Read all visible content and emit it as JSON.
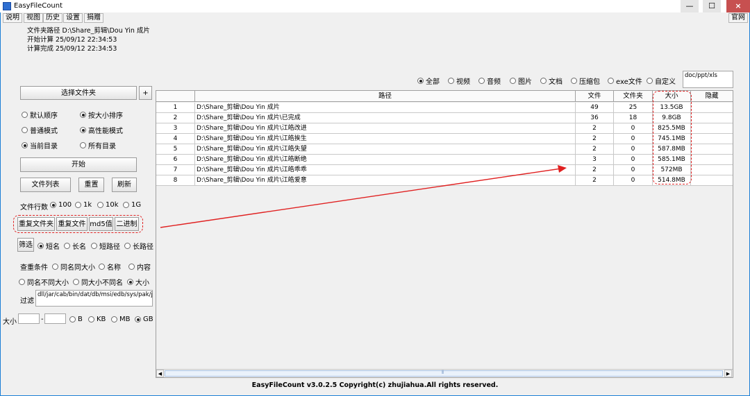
{
  "window": {
    "title": "EasyFileCount",
    "minimize_glyph": "—",
    "maximize_glyph": "☐",
    "close_glyph": "×"
  },
  "menu": [
    "说明",
    "视图",
    "历史",
    "设置",
    "捐赠"
  ],
  "homepage_label": "官网",
  "info": {
    "folder_path": "文件夹路径 D:\\Share_剪辑\\Dou Yin 成片",
    "start_time": "开始计算 25/09/12 22:34:53",
    "end_time": "计算完成 25/09/12 22:34:53"
  },
  "controls": {
    "select_folder": "选择文件夹",
    "plus": "+",
    "sort_default": "默认顺序",
    "sort_size": "按大小排序",
    "mode_normal": "普通模式",
    "mode_perf": "高性能模式",
    "dir_current": "当前目录",
    "dir_all": "所有目录",
    "start": "开始",
    "file_list": "文件列表",
    "reset": "重置",
    "refresh": "刷新",
    "line_count_label": "文件行数",
    "line_counts": [
      "100",
      "1k",
      "10k",
      "1G"
    ],
    "dup_folder": "重复文件夹",
    "dup_file": "重复文件",
    "md5": "md5值",
    "binary": "二进制",
    "filter_btn": "筛选",
    "filter_short_name": "短名",
    "filter_long_name": "长名",
    "filter_short_path": "短路径",
    "filter_long_path": "长路径",
    "dup_cond_label": "查重条件",
    "cond_same_name_size": "同名同大小",
    "cond_name": "名称",
    "cond_content": "内容",
    "cond_same_name_diff_size": "同名不同大小",
    "cond_same_size_diff_name": "同大小不同名",
    "cond_size": "大小",
    "exclude_label": "过滤",
    "exclude_value": "dll/jar/cab/bin/dat/db/msi/edb/sys/pak/jsa",
    "size_label": "大小",
    "size_dash": "-",
    "size_units": [
      "B",
      "KB",
      "MB",
      "GB"
    ]
  },
  "types": {
    "options": [
      "全部",
      "视频",
      "音频",
      "图片",
      "文档",
      "压缩包",
      "exe文件",
      "自定义"
    ],
    "selected": "全部",
    "custom_value": "doc/ppt/xls"
  },
  "table": {
    "columns": [
      "",
      "路径",
      "文件",
      "文件夹",
      "大小",
      "隐藏"
    ],
    "rows": [
      {
        "idx": "1",
        "path": "D:\\Share_剪辑\\Dou Yin 成片",
        "files": "49",
        "folders": "25",
        "size": "13.5GB",
        "hidden": ""
      },
      {
        "idx": "2",
        "path": "D:\\Share_剪辑\\Dou Yin 成片\\已完成",
        "files": "36",
        "folders": "18",
        "size": "9.8GB",
        "hidden": ""
      },
      {
        "idx": "3",
        "path": "D:\\Share_剪辑\\Dou Yin 成片\\江皓改进",
        "files": "2",
        "folders": "0",
        "size": "825.5MB",
        "hidden": ""
      },
      {
        "idx": "4",
        "path": "D:\\Share_剪辑\\Dou Yin 成片\\江皓挨生",
        "files": "2",
        "folders": "0",
        "size": "745.1MB",
        "hidden": ""
      },
      {
        "idx": "5",
        "path": "D:\\Share_剪辑\\Dou Yin 成片\\江皓失望",
        "files": "2",
        "folders": "0",
        "size": "587.8MB",
        "hidden": ""
      },
      {
        "idx": "6",
        "path": "D:\\Share_剪辑\\Dou Yin 成片\\江皓断绝",
        "files": "3",
        "folders": "0",
        "size": "585.1MB",
        "hidden": ""
      },
      {
        "idx": "7",
        "path": "D:\\Share_剪辑\\Dou Yin 成片\\江皓乖乖",
        "files": "2",
        "folders": "0",
        "size": "572MB",
        "hidden": ""
      },
      {
        "idx": "8",
        "path": "D:\\Share_剪辑\\Dou Yin 成片\\江皓爱意",
        "files": "2",
        "folders": "0",
        "size": "514.8MB",
        "hidden": ""
      }
    ]
  },
  "scroll": {
    "left_arrow": "◀",
    "right_arrow": "▶",
    "grip": "⦀"
  },
  "footer": "EasyFileCount v3.0.2.5 Copyright(c) zhujiahua.All rights reserved.",
  "colors": {
    "accent": "#1b7fd6",
    "annotation": "#e02020",
    "close": "#c75050"
  }
}
